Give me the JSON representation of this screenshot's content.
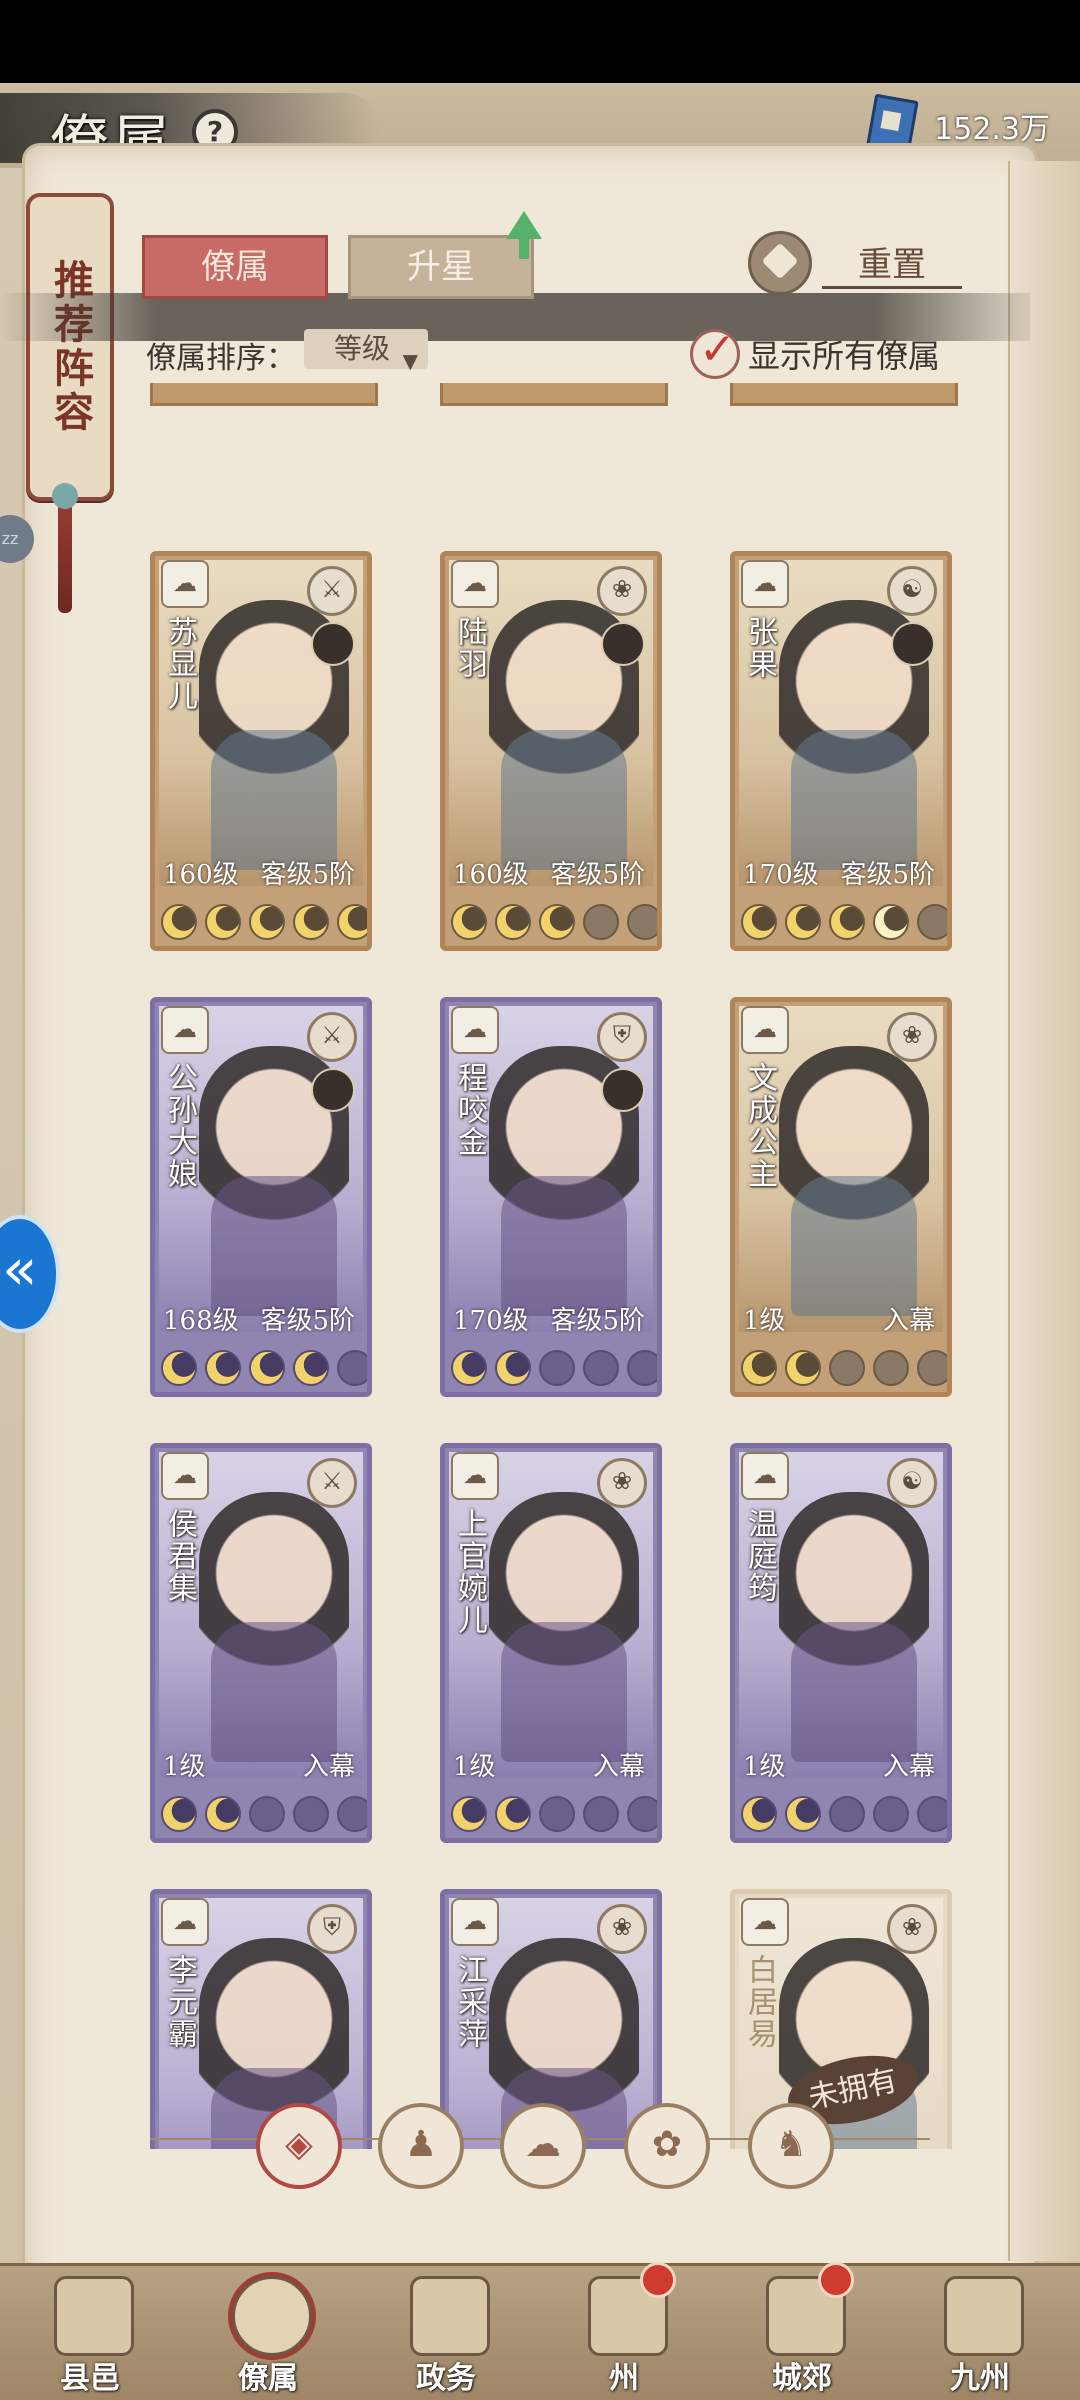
{
  "header": {
    "title": "僚属",
    "help_icon": "?",
    "currency_value": "152.3万"
  },
  "banner": {
    "text": "推荐阵容"
  },
  "tabs": [
    {
      "label": "僚属"
    },
    {
      "label": "升星"
    }
  ],
  "reset_label": "重置",
  "sort": {
    "label": "僚属排序：",
    "value": "等级"
  },
  "show_all": {
    "label": "显示所有僚属",
    "checked": true
  },
  "cards": [
    {
      "name": "苏显儿",
      "level": "160级",
      "stage": "客级5阶",
      "rarity": "gold",
      "stars": [
        1,
        1,
        1,
        1,
        1
      ],
      "role_icon": "sword"
    },
    {
      "name": "陆羽",
      "level": "160级",
      "stage": "客级5阶",
      "rarity": "gold",
      "stars": [
        1,
        1,
        1,
        0,
        0
      ],
      "role_icon": "lotus"
    },
    {
      "name": "张果",
      "level": "170级",
      "stage": "客级5阶",
      "rarity": "gold",
      "stars": [
        1,
        1,
        1,
        2,
        0
      ],
      "role_icon": "yin-yang"
    },
    {
      "name": "公孙大娘",
      "level": "168级",
      "stage": "客级5阶",
      "rarity": "purple",
      "stars": [
        1,
        1,
        1,
        1,
        0
      ],
      "role_icon": "sword"
    },
    {
      "name": "程咬金",
      "level": "170级",
      "stage": "客级5阶",
      "rarity": "purple",
      "stars": [
        1,
        1,
        0,
        0,
        0
      ],
      "role_icon": "shield"
    },
    {
      "name": "文成公主",
      "level": "1级",
      "stage": "入幕",
      "rarity": "gold",
      "stars": [
        1,
        1,
        0,
        0,
        0
      ],
      "role_icon": "lotus"
    },
    {
      "name": "侯君集",
      "level": "1级",
      "stage": "入幕",
      "rarity": "purple",
      "stars": [
        1,
        1,
        0,
        0,
        0
      ],
      "role_icon": "sword"
    },
    {
      "name": "上官婉儿",
      "level": "1级",
      "stage": "入幕",
      "rarity": "purple",
      "stars": [
        1,
        1,
        0,
        0,
        0
      ],
      "role_icon": "lotus"
    },
    {
      "name": "温庭筠",
      "level": "1级",
      "stage": "入幕",
      "rarity": "purple",
      "stars": [
        1,
        1,
        0,
        0,
        0
      ],
      "role_icon": "yin-yang"
    },
    {
      "name": "李元霸",
      "level": "",
      "stage": "",
      "rarity": "purple",
      "stars": [],
      "role_icon": "shield"
    },
    {
      "name": "江采萍",
      "level": "",
      "stage": "",
      "rarity": "purple",
      "stars": [],
      "role_icon": "lotus"
    },
    {
      "name": "白居易",
      "level": "",
      "stage": "",
      "rarity": "ghost",
      "stars": [],
      "role_icon": "lotus",
      "unowned": "未拥有"
    }
  ],
  "filters": [
    {
      "icon": "all-filter-icon",
      "glyph": "◈",
      "active": true
    },
    {
      "icon": "faction-helmet-icon",
      "glyph": "♟",
      "active": false
    },
    {
      "icon": "faction-cloud-icon",
      "glyph": "☁",
      "active": false
    },
    {
      "icon": "faction-fan-icon",
      "glyph": "✿",
      "active": false
    },
    {
      "icon": "faction-beast-icon",
      "glyph": "♞",
      "active": false
    }
  ],
  "nav": [
    {
      "label": "县邑",
      "badge": false,
      "active": false
    },
    {
      "label": "僚属",
      "badge": false,
      "active": true
    },
    {
      "label": "政务",
      "badge": false,
      "active": false
    },
    {
      "label": "州",
      "badge": true,
      "active": false
    },
    {
      "label": "城郊",
      "badge": true,
      "active": false
    },
    {
      "label": "九州",
      "badge": false,
      "active": false
    }
  ],
  "colors": {
    "accent_red": "#c86a66",
    "gold_card": "#c3a078",
    "purple_card": "#9085b1"
  }
}
